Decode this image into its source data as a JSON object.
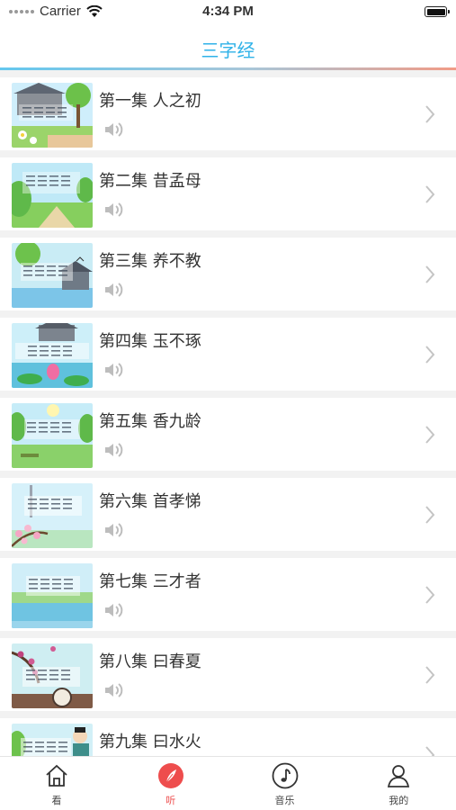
{
  "status_bar": {
    "carrier": "Carrier",
    "time": "4:34 PM"
  },
  "nav": {
    "title": "三字经"
  },
  "episodes": [
    {
      "title": "第一集 人之初",
      "scene": "house-flowers"
    },
    {
      "title": "第二集 昔孟母",
      "scene": "meadow"
    },
    {
      "title": "第三集 养不教",
      "scene": "riverside-house"
    },
    {
      "title": "第四集 玉不琢",
      "scene": "lotus-pond"
    },
    {
      "title": "第五集 香九龄",
      "scene": "sunny-field"
    },
    {
      "title": "第六集 首孝悌",
      "scene": "blossom-branch"
    },
    {
      "title": "第七集 三才者",
      "scene": "lake"
    },
    {
      "title": "第八集 曰春夏",
      "scene": "plum-garden"
    },
    {
      "title": "第九集 曰水火",
      "scene": "scholar"
    }
  ],
  "tabs": [
    {
      "label": "看",
      "icon": "house-icon",
      "active": false
    },
    {
      "label": "听",
      "icon": "feather-icon",
      "active": true
    },
    {
      "label": "音乐",
      "icon": "music-note-icon",
      "active": false
    },
    {
      "label": "我的",
      "icon": "person-icon",
      "active": false
    }
  ],
  "colors": {
    "accent_blue": "#2fb2e8",
    "active_tab": "#ee4d4d",
    "divider_gradient_start": "#64c7ee",
    "divider_gradient_end": "#f19b86"
  }
}
